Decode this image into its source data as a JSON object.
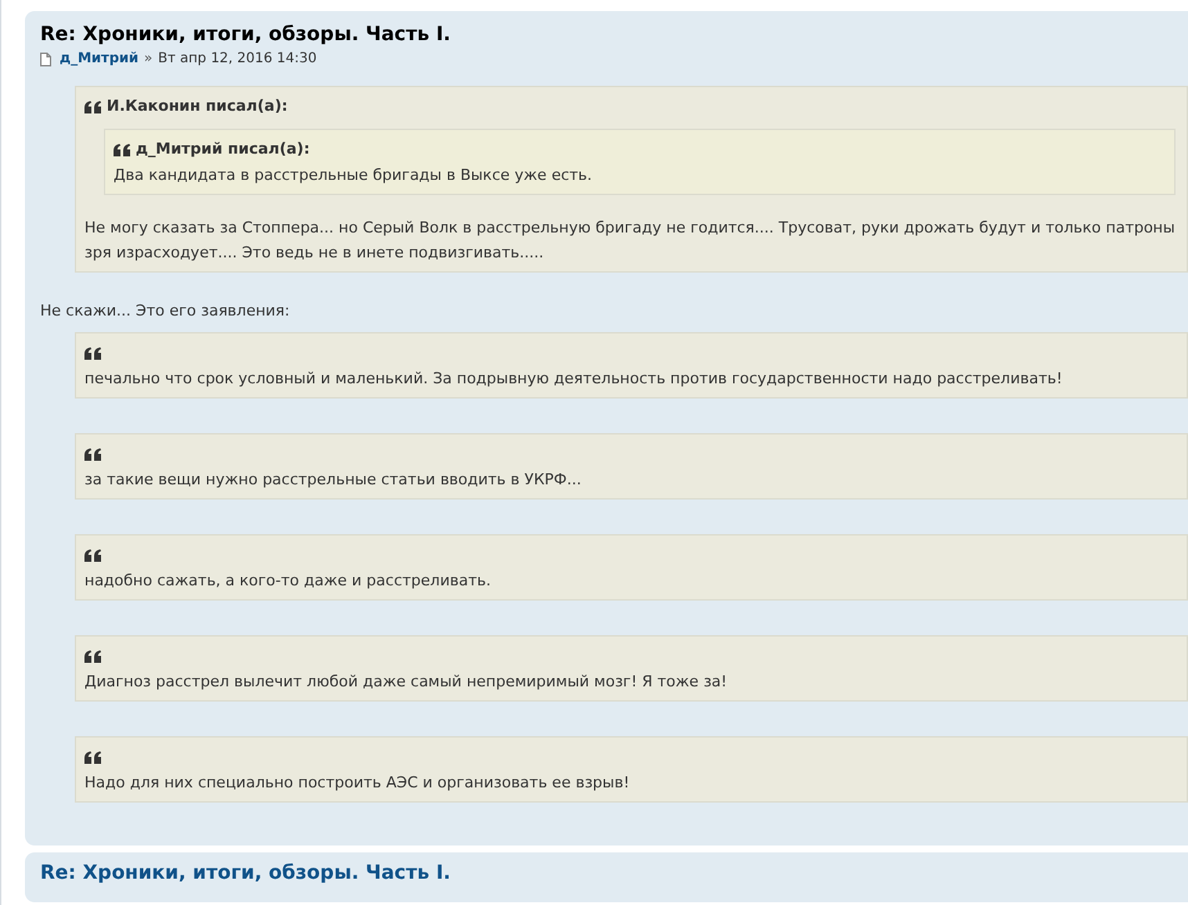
{
  "post": {
    "title": "Re: Хроники, итоги, обзоры. Часть I.",
    "author": "д_Митрий",
    "separator": "»",
    "date": "Вт апр 12, 2016 14:30",
    "content": [
      {
        "kind": "quote",
        "author": "И.Каконин писал(а):",
        "blocks": [
          {
            "kind": "quote",
            "author": "д_Митрий писал(а):",
            "blocks": [
              {
                "kind": "text",
                "text": "Два кандидата в расстрельные бригады в Выксе уже есть."
              }
            ]
          },
          {
            "kind": "text",
            "text": "Не могу сказать за Стоппера... но Серый Волк в расстрельную бригаду не годится.... Трусоват, руки дрожать будут и только патроны зря израсходует.... Это ведь не в инете подвизгивать....."
          }
        ]
      },
      {
        "kind": "text",
        "text": "Не скажи... Это его заявления:"
      },
      {
        "kind": "quote",
        "blocks": [
          {
            "kind": "text",
            "text": "печально что срок условный и маленький. За подрывную деятельность против государственности надо расстреливать!"
          }
        ]
      },
      {
        "kind": "quote",
        "blocks": [
          {
            "kind": "text",
            "text": "за такие вещи нужно расстрельные статьи вводить в УКРФ..."
          }
        ]
      },
      {
        "kind": "quote",
        "blocks": [
          {
            "kind": "text",
            "text": "надобно сажать, а кого-то даже и расстреливать."
          }
        ]
      },
      {
        "kind": "quote",
        "blocks": [
          {
            "kind": "text",
            "text": "Диагноз расстрел вылечит любой даже самый непремиримый мозг! Я тоже за!"
          }
        ]
      },
      {
        "kind": "quote",
        "blocks": [
          {
            "kind": "text",
            "text": "Надо для них специально построить АЭС и организовать ее взрыв!"
          }
        ]
      }
    ]
  },
  "next_post": {
    "title": "Re: Хроники, итоги, обзоры. Часть I."
  }
}
